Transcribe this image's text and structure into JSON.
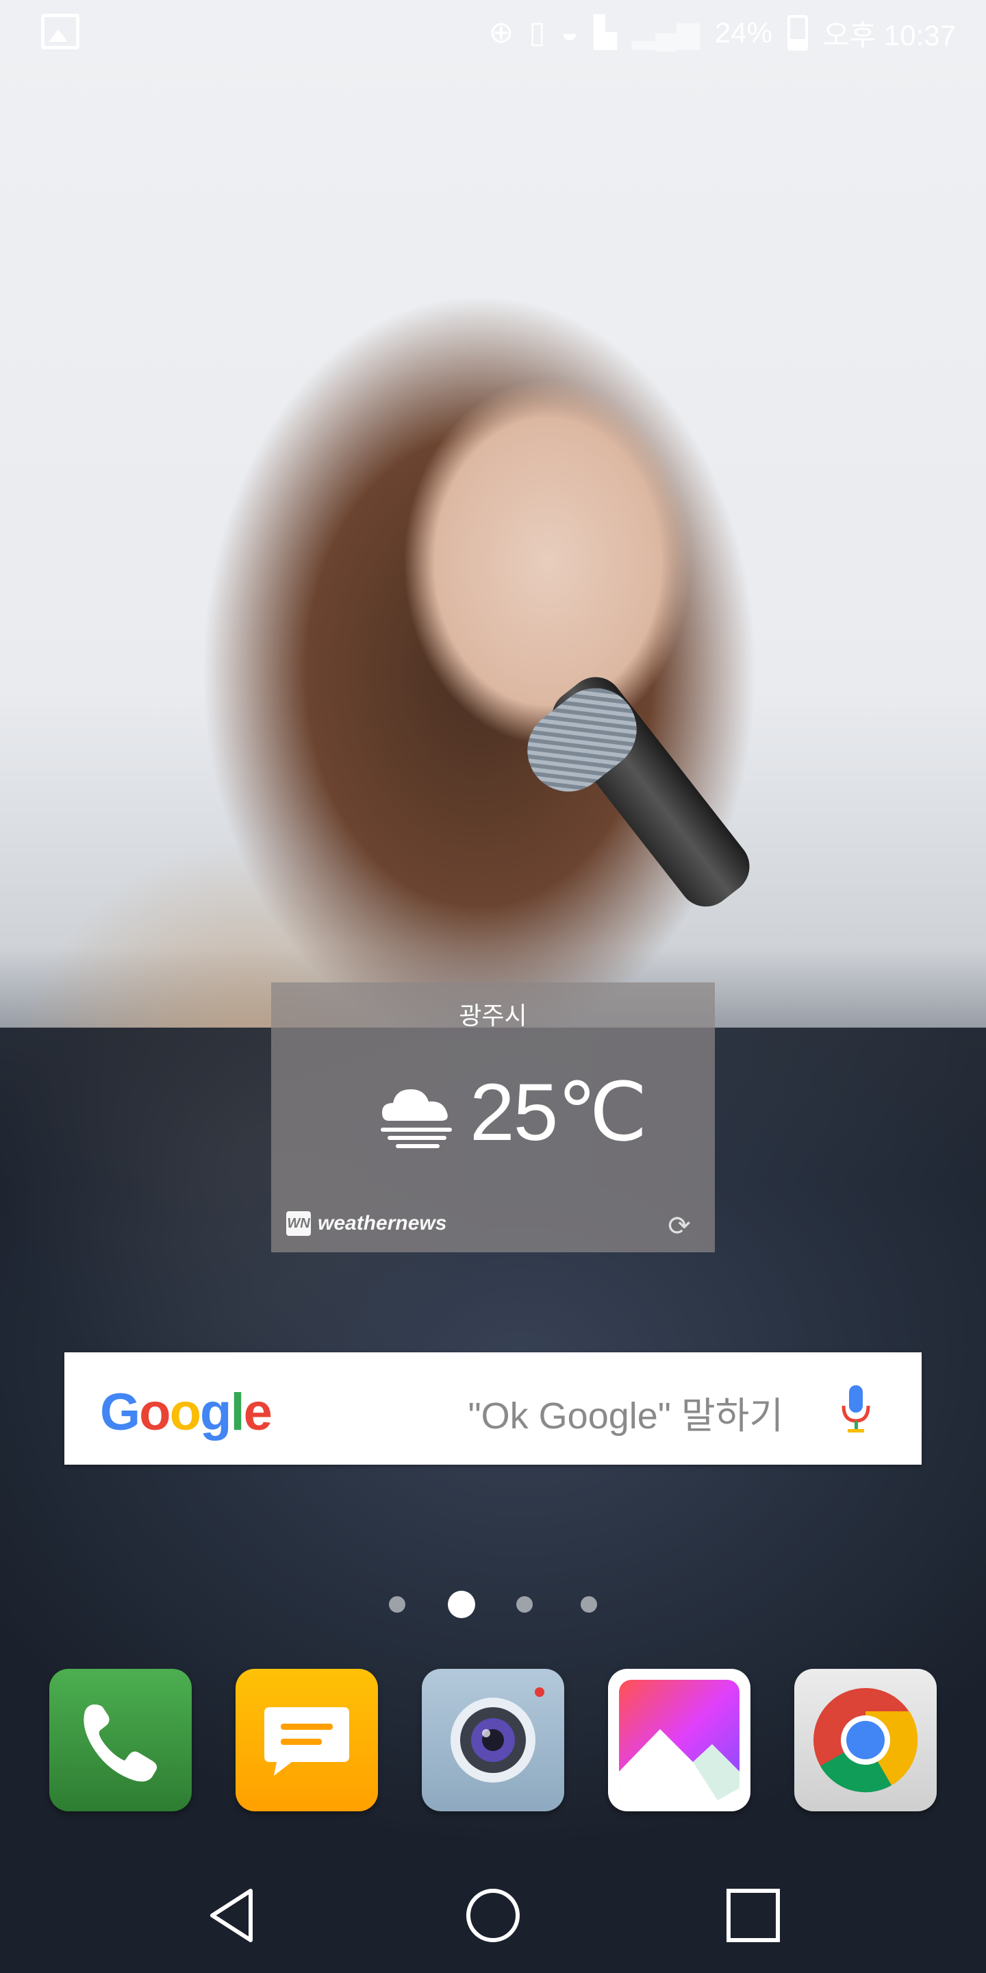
{
  "status_bar": {
    "battery_percent": "24%",
    "time": "오후 10:37",
    "icons": [
      "gallery-notification-icon",
      "data-saver-icon",
      "vibrate-icon",
      "wifi-locked-icon",
      "sim-off-icon",
      "signal-icon",
      "battery-icon"
    ]
  },
  "weather_widget": {
    "city": "광주시",
    "temperature": "25℃",
    "condition_icon": "cloud-fog-icon",
    "provider": "weathernews",
    "provider_mark": "WN"
  },
  "search_bar": {
    "logo_letters": [
      "G",
      "o",
      "o",
      "g",
      "l",
      "e"
    ],
    "logo_colors": [
      "#4285F4",
      "#EA4335",
      "#FBBC05",
      "#4285F4",
      "#34A853",
      "#EA4335"
    ],
    "hint": "\"Ok Google\" 말하기"
  },
  "pager": {
    "page_count": 4,
    "active_index": 1
  },
  "dock": {
    "apps": [
      {
        "name": "phone",
        "icon": "phone-icon",
        "color": "#43A047"
      },
      {
        "name": "messages",
        "icon": "message-icon",
        "color": "#FFB300"
      },
      {
        "name": "camera",
        "icon": "camera-icon",
        "color": "#9FB8CC"
      },
      {
        "name": "gallery",
        "icon": "gallery-icon",
        "color": "#FFFFFF"
      },
      {
        "name": "chrome",
        "icon": "chrome-icon",
        "color": "#E0E0E0"
      }
    ]
  },
  "nav_bar": {
    "buttons": [
      "back-icon",
      "home-icon",
      "recents-icon"
    ]
  }
}
